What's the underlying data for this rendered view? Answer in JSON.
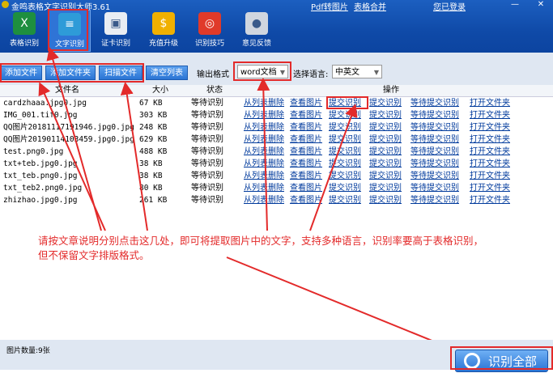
{
  "window": {
    "title": "金鸣表格文字识别大师3.61",
    "links": [
      "Pdf转图片",
      "表格合并",
      "您已登录"
    ],
    "minimize": "—",
    "close": "✕"
  },
  "tools": [
    {
      "label": "表格识别",
      "icon": "excel-icon",
      "color": "#1e8f3f",
      "glyph": "X"
    },
    {
      "label": "文字识别",
      "icon": "document-icon",
      "color": "#2e9bd8",
      "glyph": "≡"
    },
    {
      "label": "证卡识别",
      "icon": "id-card-icon",
      "color": "#e9edf3",
      "glyph": "▣"
    },
    {
      "label": "充值升级",
      "icon": "coin-icon",
      "color": "#f0b000",
      "glyph": "$"
    },
    {
      "label": "识别技巧",
      "icon": "tips-icon",
      "color": "#e03a2a",
      "glyph": "◎"
    },
    {
      "label": "意见反馈",
      "icon": "feedback-icon",
      "color": "#d0d6df",
      "glyph": "●"
    }
  ],
  "toolbar": {
    "add_file": "添加文件",
    "add_folder": "添加文件夹",
    "scan": "扫描文件",
    "clear": "清空列表",
    "output_label": "输出格式",
    "output_value": "word文档",
    "lang_label": "选择语言:",
    "lang_value": "中英文"
  },
  "table": {
    "headers": [
      "文件名",
      "大小",
      "状态",
      "操作"
    ],
    "rows": [
      {
        "name": "cardzhaaa.jpg0.jpg",
        "size": "67 KB",
        "status": "等待识别"
      },
      {
        "name": "IMG_001.tif0.jpg",
        "size": "303 KB",
        "status": "等待识别"
      },
      {
        "name": "QQ图片20181117191946.jpg0.jpg",
        "size": "248 KB",
        "status": "等待识别"
      },
      {
        "name": "QQ图片20190114103459.jpg0.jpg",
        "size": "629 KB",
        "status": "等待识别"
      },
      {
        "name": "test.png0.jpg",
        "size": "488 KB",
        "status": "等待识别"
      },
      {
        "name": "txt+teb.jpg0.jpg",
        "size": "38 KB",
        "status": "等待识别"
      },
      {
        "name": "txt_teb.png0.jpg",
        "size": "38 KB",
        "status": "等待识别"
      },
      {
        "name": "txt_teb2.png0.jpg",
        "size": "80 KB",
        "status": "等待识别"
      },
      {
        "name": "zhizhao.jpg0.jpg",
        "size": "261 KB",
        "status": "等待识别"
      }
    ],
    "actions": [
      "从列表删除",
      "查看图片",
      "提交识别",
      "提交识别",
      "等待提交识别",
      "打开文件夹"
    ]
  },
  "annotation": {
    "line1": "请按文章说明分别点击这几处，即可将提取图片中的文字，支持多种语言，识别率要高于表格识别，",
    "line2": "但不保留文字排版格式。"
  },
  "status": {
    "count": "图片数量:9张",
    "run_button": "识别全部"
  },
  "colors": {
    "title_bar": "#0f4aa8",
    "accent_button": "#2a74d4",
    "annotation_red": "#e32a2a",
    "link": "#003a9c"
  }
}
